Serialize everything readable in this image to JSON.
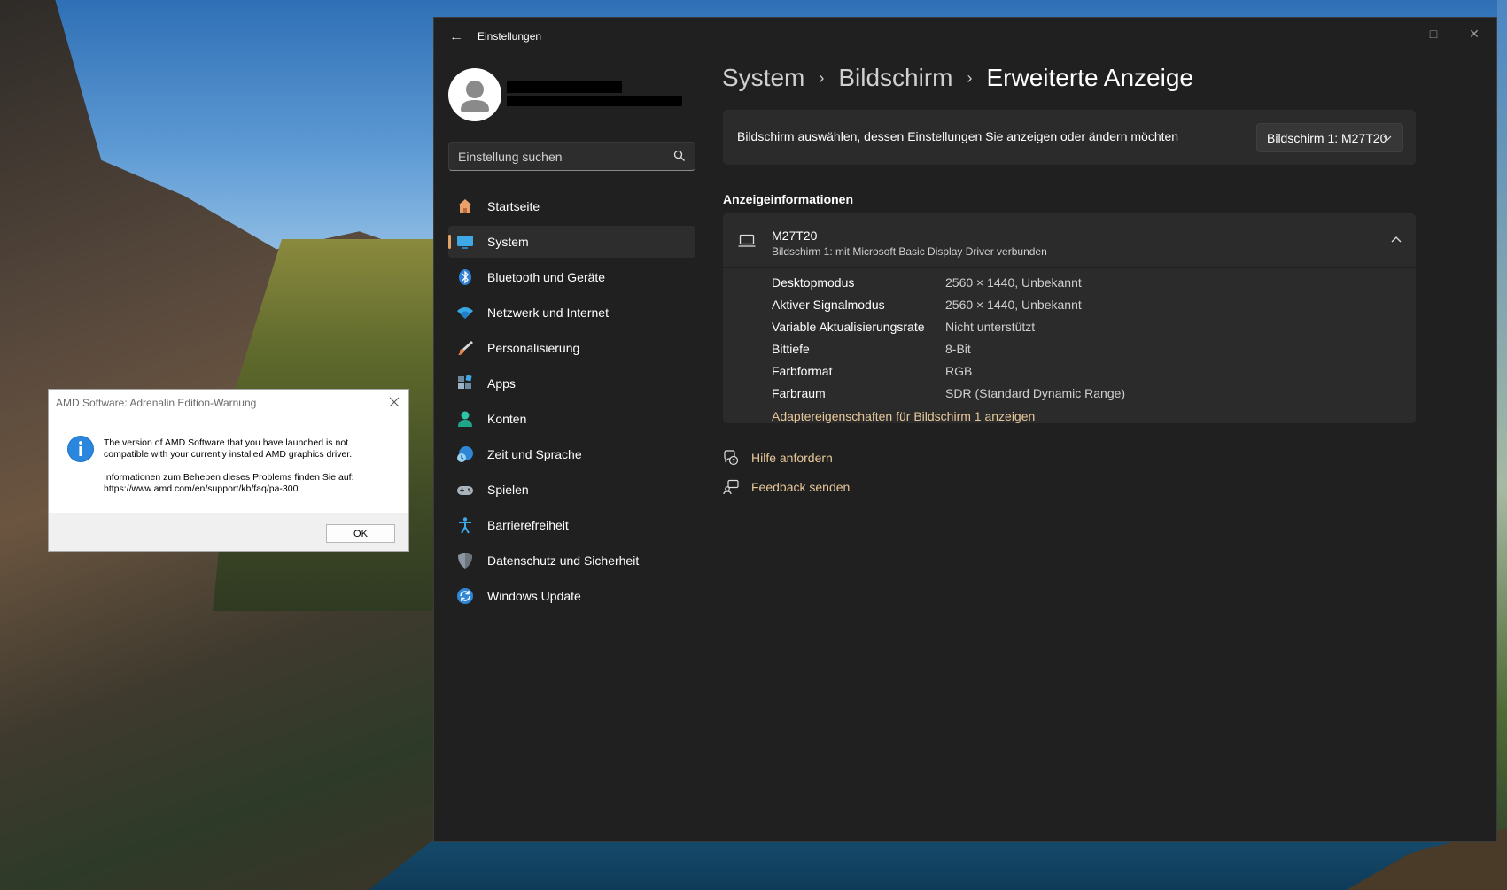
{
  "settings_window": {
    "title": "Einstellungen",
    "search": {
      "placeholder": "Einstellung suchen"
    },
    "nav_items": [
      {
        "label": "Startseite",
        "icon": "home-icon"
      },
      {
        "label": "System",
        "icon": "monitor-icon",
        "active": true
      },
      {
        "label": "Bluetooth und Geräte",
        "icon": "bluetooth-icon"
      },
      {
        "label": "Netzwerk und Internet",
        "icon": "wifi-icon"
      },
      {
        "label": "Personalisierung",
        "icon": "brush-icon"
      },
      {
        "label": "Apps",
        "icon": "apps-icon"
      },
      {
        "label": "Konten",
        "icon": "person-icon"
      },
      {
        "label": "Zeit und Sprache",
        "icon": "clock-globe-icon"
      },
      {
        "label": "Spielen",
        "icon": "gamepad-icon"
      },
      {
        "label": "Barrierefreiheit",
        "icon": "accessibility-icon"
      },
      {
        "label": "Datenschutz und Sicherheit",
        "icon": "shield-icon"
      },
      {
        "label": "Windows Update",
        "icon": "update-icon"
      }
    ],
    "breadcrumb": [
      "System",
      "Bildschirm",
      "Erweiterte Anzeige"
    ],
    "select_card": {
      "text": "Bildschirm auswählen, dessen Einstellungen Sie anzeigen oder ändern möchten",
      "dropdown_value": "Bildschirm 1: M27T20"
    },
    "section_title": "Anzeigeinformationen",
    "display_info": {
      "name": "M27T20",
      "subtitle": "Bildschirm 1: mit Microsoft Basic Display Driver verbunden",
      "rows": [
        {
          "key": "Desktopmodus",
          "value": "2560 × 1440, Unbekannt"
        },
        {
          "key": "Aktiver Signalmodus",
          "value": "2560 × 1440, Unbekannt"
        },
        {
          "key": "Variable Aktualisierungsrate",
          "value": "Nicht unterstützt"
        },
        {
          "key": "Bittiefe",
          "value": "8-Bit"
        },
        {
          "key": "Farbformat",
          "value": "RGB"
        },
        {
          "key": "Farbraum",
          "value": "SDR (Standard Dynamic Range)"
        }
      ],
      "adapter_link": "Adaptereigenschaften für Bildschirm 1 anzeigen"
    },
    "help_links": [
      {
        "label": "Hilfe anfordern",
        "icon": "help-chat-icon"
      },
      {
        "label": "Feedback senden",
        "icon": "feedback-icon"
      }
    ],
    "accent_color": "#e7c89a"
  },
  "amd_dialog": {
    "title": "AMD Software: Adrenalin Edition-Warnung",
    "message_line1": "The version of AMD Software that you have launched is not",
    "message_line2": "compatible with your currently installed AMD graphics driver.",
    "info_line1": "Informationen zum Beheben dieses Problems finden Sie auf:",
    "info_line2": "https://www.amd.com/en/support/kb/faq/pa-300",
    "ok_label": "OK"
  }
}
